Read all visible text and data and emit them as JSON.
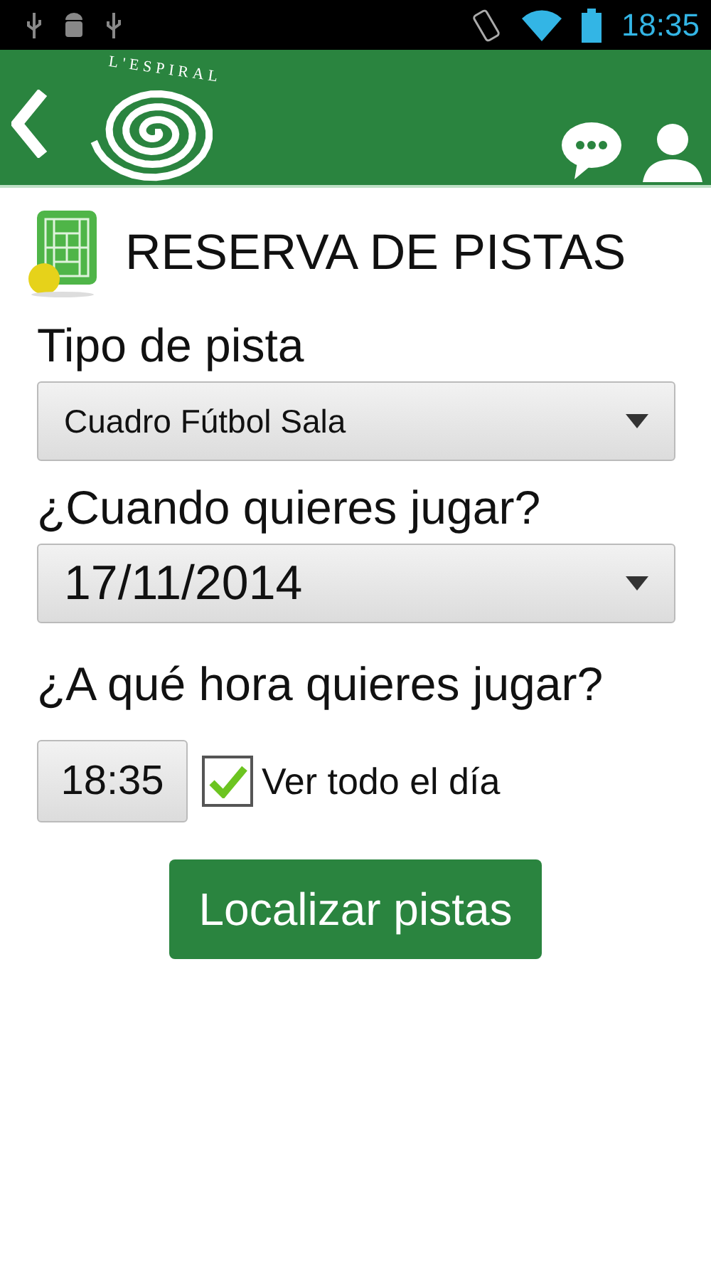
{
  "status_bar": {
    "time": "18:35"
  },
  "header": {
    "logo_text": "L'ESPIRAL"
  },
  "title": "RESERVA DE PISTAS",
  "fields": [
    {
      "kind": "dropdown",
      "label": "Tipo de pista",
      "value": "Cuadro Fútbol Sala",
      "large": false
    },
    {
      "kind": "dropdown",
      "label": "¿Cuando quieres jugar?",
      "value": "17/11/2014",
      "large": true
    }
  ],
  "time_section": {
    "label": "¿A qué hora quieres jugar?",
    "time": "18:35",
    "checkbox": {
      "label": "Ver todo el día",
      "checked": true
    }
  },
  "submit_button": "Localizar pistas"
}
